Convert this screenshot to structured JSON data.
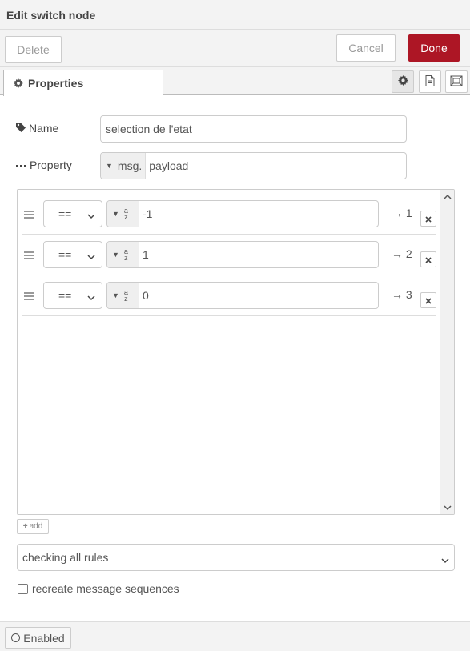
{
  "dialog": {
    "title": "Edit switch node"
  },
  "toolbar": {
    "delete_label": "Delete",
    "cancel_label": "Cancel",
    "done_label": "Done",
    "done_color": "#ad1625"
  },
  "tabs": {
    "properties_label": "Properties",
    "icons": [
      "gear-icon",
      "document-icon",
      "frame-icon"
    ]
  },
  "form": {
    "name_label": "Name",
    "name_value": "selection de l'etat",
    "property_label": "Property",
    "property_prefix": "msg.",
    "property_value": "payload"
  },
  "rules": [
    {
      "operator": "==",
      "type_top": "a",
      "type_bottom": "z",
      "value": "-1",
      "output": "→ 1"
    },
    {
      "operator": "==",
      "type_top": "a",
      "type_bottom": "z",
      "value": "1",
      "output": "→ 2"
    },
    {
      "operator": "==",
      "type_top": "a",
      "type_bottom": "z",
      "value": "0",
      "output": "→ 3"
    }
  ],
  "add_label": "add",
  "mode_select_value": "checking all rules",
  "recreate_label": "recreate message sequences",
  "footer": {
    "enabled_label": "Enabled"
  }
}
